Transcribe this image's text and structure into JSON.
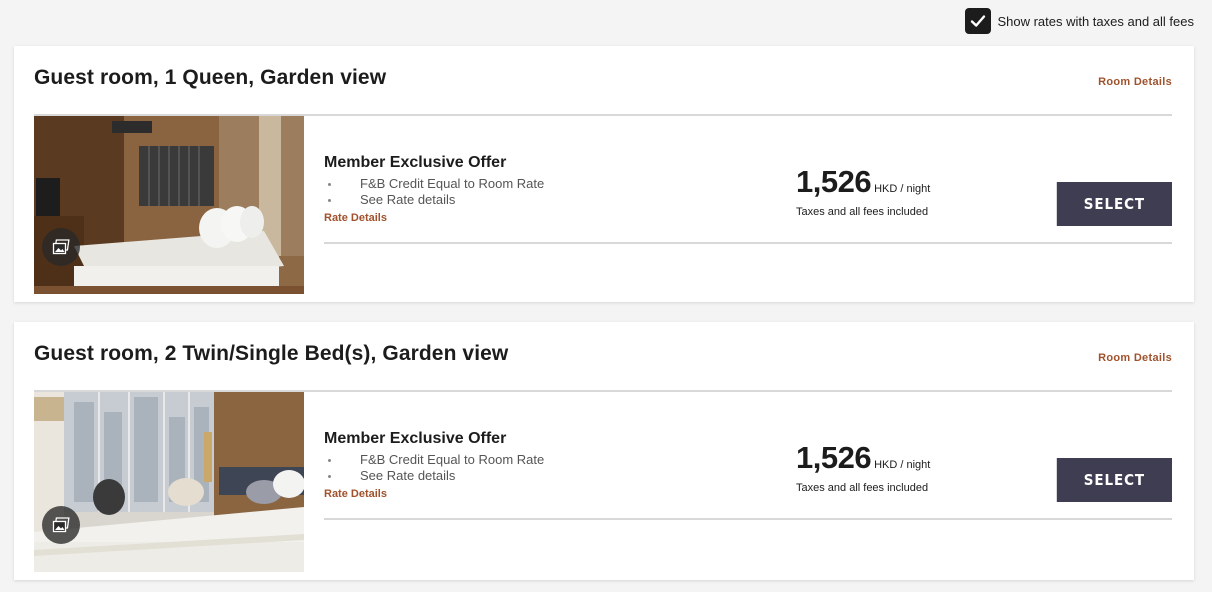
{
  "tax_toggle": {
    "label": "Show rates with taxes and all fees",
    "checked": true
  },
  "rooms": [
    {
      "title": "Guest room, 1 Queen, Garden view",
      "room_details_label": "Room Details",
      "offer": {
        "title": "Member Exclusive Offer",
        "bullets": [
          "F&B Credit Equal to Room Rate",
          "See Rate details"
        ],
        "rate_details_label": "Rate Details"
      },
      "price": {
        "amount": "1,526",
        "unit": "HKD / night",
        "note": "Taxes and all fees included"
      },
      "select_label": "SELECT"
    },
    {
      "title": "Guest room, 2 Twin/Single Bed(s), Garden view",
      "room_details_label": "Room Details",
      "offer": {
        "title": "Member Exclusive Offer",
        "bullets": [
          "F&B Credit Equal to Room Rate",
          "See Rate details"
        ],
        "rate_details_label": "Rate Details"
      },
      "price": {
        "amount": "1,526",
        "unit": "HKD / night",
        "note": "Taxes and all fees included"
      },
      "select_label": "SELECT"
    }
  ],
  "colors": {
    "accent_link": "#a0522d",
    "select_button": "#3f3d52",
    "page_background": "#f4f4f4"
  },
  "icons": {
    "checkbox": "checkmark-icon",
    "gallery": "photo-gallery-icon"
  }
}
